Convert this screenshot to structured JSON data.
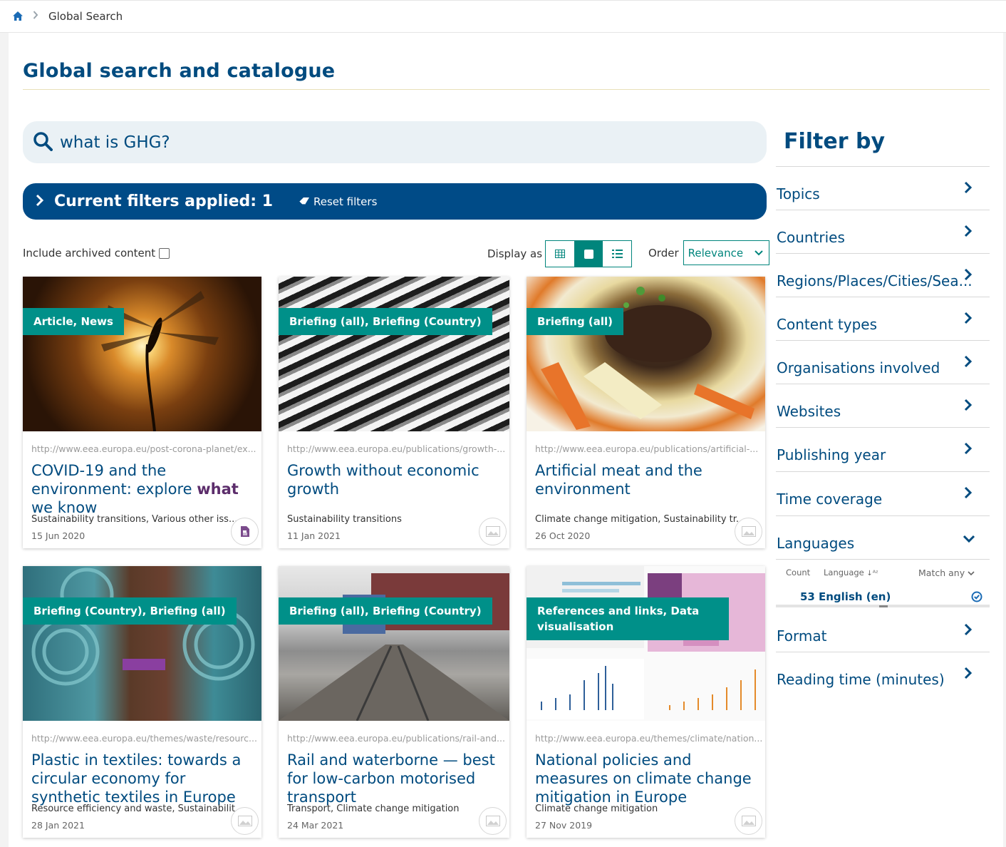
{
  "breadcrumb": {
    "current": "Global Search"
  },
  "page": {
    "title": "Global search and catalogue"
  },
  "search": {
    "query": "what is GHG?"
  },
  "filters_bar": {
    "title": "Current filters applied: 1",
    "reset_label": "Reset filters"
  },
  "controls": {
    "include_archived_label": "Include archived content",
    "display_as_label": "Display as",
    "order_label": "Order",
    "order_value": "Relevance"
  },
  "cards": [
    {
      "tag": "Article, News",
      "url": "http://www.eea.europa.eu/post-corona-planet/ex...",
      "title_pre": "COVID-19 and the environment: explore ",
      "title_hl": "what",
      "title_post": " we know",
      "meta": "Sustainability transitions, Various other iss...",
      "date": "15 Jun 2020",
      "icon": "document-icon"
    },
    {
      "tag": "Briefing (all), Briefing (Country)",
      "url": "http://www.eea.europa.eu/publications/growth-...",
      "title_pre": "Growth without economic growth",
      "title_hl": "",
      "title_post": "",
      "meta": "Sustainability transitions",
      "date": "11 Jan 2021",
      "icon": "image-icon"
    },
    {
      "tag": "Briefing (all)",
      "url": "http://www.eea.europa.eu/publications/artificial-...",
      "title_pre": "Artificial meat and the environment",
      "title_hl": "",
      "title_post": "",
      "meta": "Climate change mitigation, Sustainability tr...",
      "date": "26 Oct 2020",
      "icon": "image-icon"
    },
    {
      "tag": "Briefing (Country), Briefing (all)",
      "url": "http://www.eea.europa.eu/themes/waste/resourc...",
      "title_pre": "Plastic in textiles: towards a circular economy for synthetic textiles in Europe",
      "title_hl": "",
      "title_post": "",
      "meta": "Resource efficiency and waste, Sustainabilit...",
      "date": "28 Jan 2021",
      "icon": "image-icon"
    },
    {
      "tag": "Briefing (all), Briefing (Country)",
      "url": "http://www.eea.europa.eu/publications/rail-and...",
      "title_pre": "Rail and waterborne — best for low-carbon motorised transport",
      "title_hl": "",
      "title_post": "",
      "meta": "Transport, Climate change mitigation",
      "date": "24 Mar 2021",
      "icon": "image-icon"
    },
    {
      "tag": "References and links, Data visualisation",
      "url": "http://www.eea.europa.eu/themes/climate/nation...",
      "title_pre": "National policies and measures on climate change mitigation in Europe",
      "title_hl": "",
      "title_post": "",
      "meta": "Climate change mitigation",
      "date": "27 Nov 2019",
      "icon": "image-icon"
    }
  ],
  "sidebar": {
    "title": "Filter by",
    "facets": [
      "Topics",
      "Countries",
      "Regions/Places/Cities/Sea...",
      "Content types",
      "Organisations involved",
      "Websites",
      "Publishing year",
      "Time coverage",
      "Languages",
      "Format",
      "Reading time (minutes)"
    ],
    "languages": {
      "count_label": "Count",
      "language_label": "Language",
      "match_label": "Match any",
      "entry_count": "53",
      "entry_label": "English (en)"
    }
  },
  "colors": {
    "brand": "#004b7f",
    "accent": "#009089",
    "filters_bar": "#004b87",
    "highlight": "#5c2d6b"
  }
}
